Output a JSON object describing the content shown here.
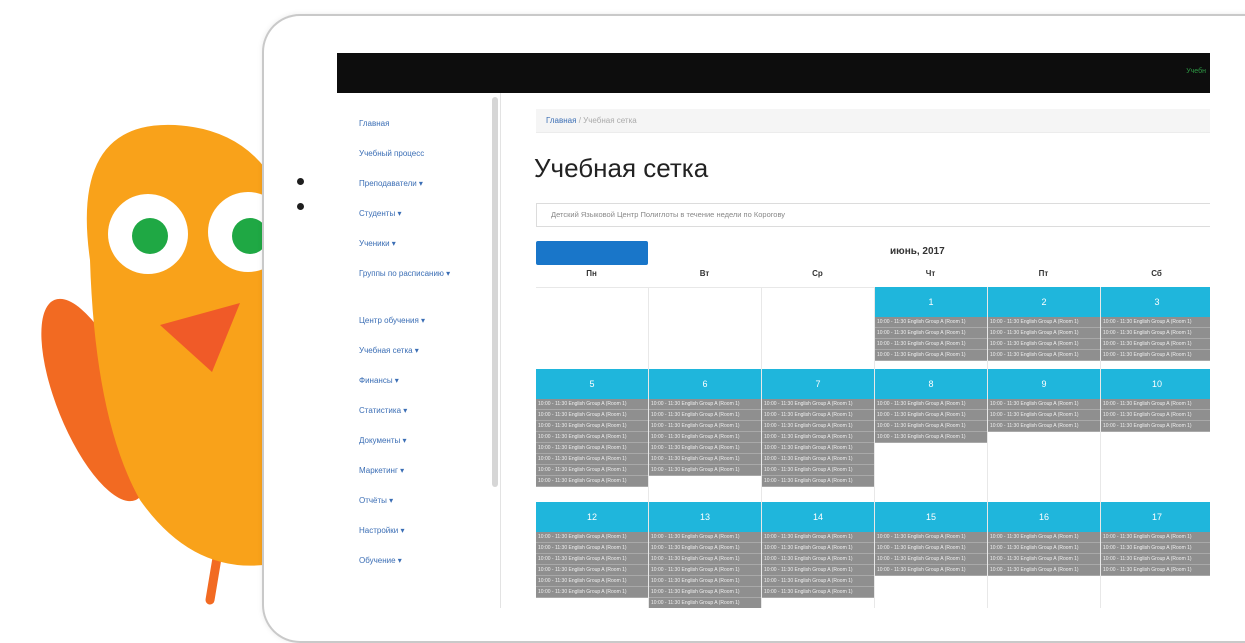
{
  "screen": {
    "user_label": "Учебн",
    "sidebar": {
      "items": [
        "Главная",
        "Учебный процесс",
        "Преподаватели ▾",
        "Студенты ▾",
        "Ученики ▾",
        "Группы по расписанию ▾",
        "Центр обучения ▾",
        "Учебная сетка ▾",
        "Финансы ▾",
        "Статистика ▾",
        "Документы ▾",
        "Маркетинг ▾",
        "Отчёты ▾",
        "Настройки ▾",
        "Обучение ▾"
      ]
    },
    "breadcrumb": {
      "home": "Главная",
      "current": "/ Учебная сетка"
    },
    "title": "Учебная сетка",
    "filter_value": "Детский Языковой Центр Полиглоты в течение недели по Корогову",
    "action_button": "",
    "month_label": "июнь, 2017",
    "weekdays": [
      "Пн",
      "Вт",
      "Ср",
      "Чт",
      "Пт",
      "Сб"
    ],
    "weeks": [
      {
        "days": [
          null,
          null,
          null,
          "1",
          "2",
          "3"
        ]
      },
      {
        "days": [
          "5",
          "6",
          "7",
          "8",
          "9",
          "10"
        ]
      },
      {
        "days": [
          "12",
          "13",
          "14",
          "15",
          "16",
          "17"
        ]
      }
    ],
    "lesson_text": "10:00 - 11:30 English Group A (Room 1)",
    "colors": {
      "day_header": "#1fb6dc",
      "lesson_bg": "#8f8f8f",
      "primary_button": "#1976c9",
      "mascot_body": "#f9a21a",
      "mascot_beak": "#f05a28",
      "mascot_eye": "#1fa844"
    }
  }
}
